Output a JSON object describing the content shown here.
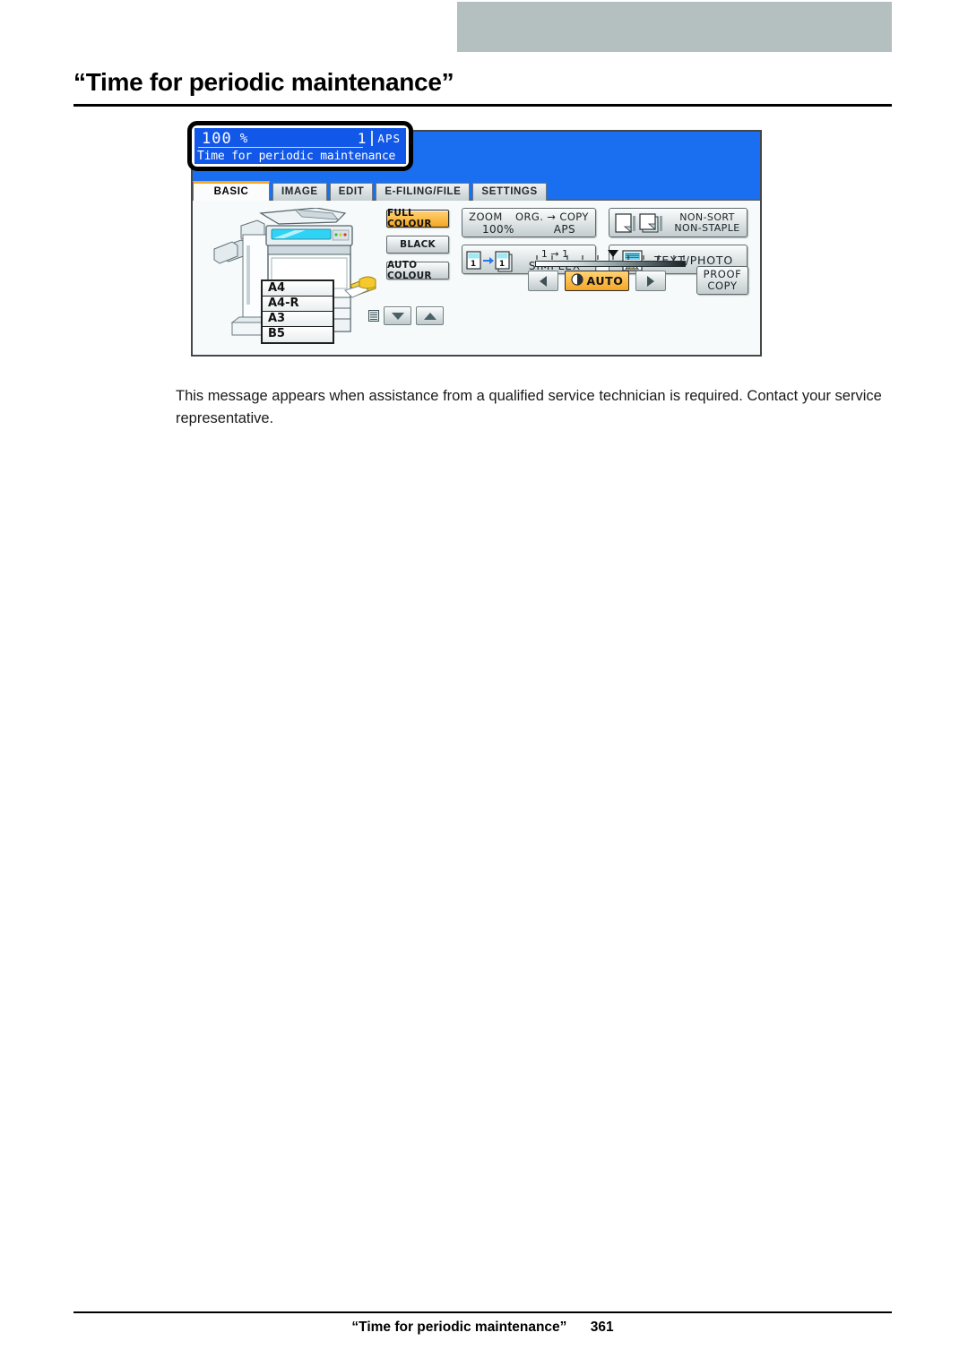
{
  "page": {
    "title": "“Time for periodic maintenance”",
    "body": "This message appears when assistance from a qualified service technician is required. Contact your service representative.",
    "footer_title": "“Time for periodic maintenance”",
    "footer_page": "361"
  },
  "colors": {
    "header_block": "#b4bfbf",
    "panel_blue": "#1a6ef0",
    "lcd_blue": "#1157e8",
    "accent_orange": "#f5a623",
    "panel_face": "#f7fafa"
  },
  "panel": {
    "status": {
      "zoom_value": "100",
      "zoom_unit": "%",
      "copy_count": "1",
      "paper_mode": "APS",
      "message": "Time for periodic maintenance"
    },
    "tabs": [
      {
        "label": "BASIC",
        "active": true
      },
      {
        "label": "IMAGE",
        "active": false
      },
      {
        "label": "EDIT",
        "active": false
      },
      {
        "label": "E-FILING/FILE",
        "active": false
      },
      {
        "label": "SETTINGS",
        "active": false
      }
    ],
    "paper_trays": [
      {
        "label": "A4"
      },
      {
        "label": "A4-R"
      },
      {
        "label": "A3"
      },
      {
        "label": "B5"
      }
    ],
    "colour_modes": [
      {
        "label": "FULL COLOUR",
        "selected": true
      },
      {
        "label": "BLACK",
        "selected": false
      },
      {
        "label": "AUTO COLOUR",
        "selected": false
      }
    ],
    "zoom_button": {
      "zoom_label": "ZOOM",
      "zoom_value": "100%",
      "org_copy_label": "ORG. → COPY",
      "org_copy_value": "APS"
    },
    "duplex_button": {
      "line1": "1 → 1",
      "line2": "SIMPLEX"
    },
    "finisher_button": {
      "line1": "NON-SORT",
      "line2": "NON-STAPLE"
    },
    "original_mode_button": {
      "label": "TEXT/PHOTO"
    },
    "density": {
      "auto_label": "AUTO",
      "lighter_icon": "arrow-left-icon",
      "darker_icon": "arrow-right-icon"
    },
    "proof_copy_button": {
      "line1": "PROOF",
      "line2": "COPY"
    },
    "tray_scroll": {
      "down_icon": "arrow-down-icon",
      "up_icon": "arrow-up-icon"
    }
  }
}
